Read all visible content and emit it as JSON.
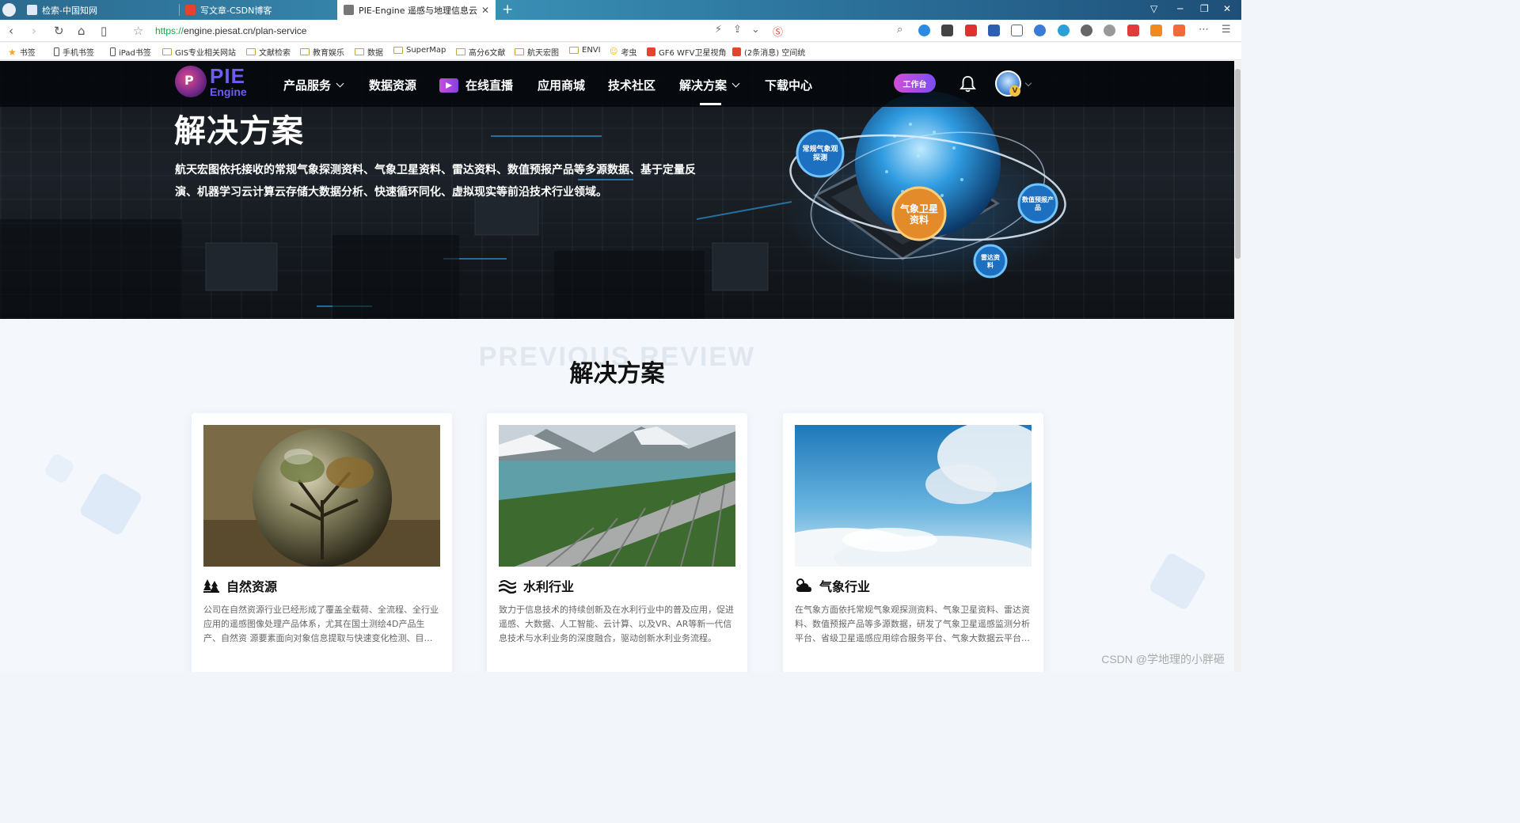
{
  "browser": {
    "tabs": [
      {
        "title": "检索-中国知网",
        "color": "#3b5b9b"
      },
      {
        "title": "写文章-CSDN博客",
        "color": "#e5432f"
      },
      {
        "title": "PIE-Engine 遥感与地理信息云服务平",
        "color": "#555555"
      }
    ],
    "url_scheme": "https://",
    "url_rest": "engine.piesat.cn/plan-service",
    "bookmarks": [
      {
        "label": "书签",
        "type": "star"
      },
      {
        "label": "手机书签",
        "type": "phone"
      },
      {
        "label": "iPad书签",
        "type": "phone"
      },
      {
        "label": "GIS专业相关网站",
        "type": "folder"
      },
      {
        "label": "文献检索",
        "type": "folder"
      },
      {
        "label": "教育娱乐",
        "type": "folder"
      },
      {
        "label": "数据",
        "type": "folder"
      },
      {
        "label": "SuperMap",
        "type": "folder"
      },
      {
        "label": "高分6文献",
        "type": "folder"
      },
      {
        "label": "航天宏图",
        "type": "folder"
      },
      {
        "label": "ENVI",
        "type": "folder"
      },
      {
        "label": "考虫",
        "type": "emoji"
      },
      {
        "label": "GF6 WFV卫星视角",
        "type": "csdn"
      },
      {
        "label": "(2条消息) 空间统",
        "type": "csdn"
      }
    ]
  },
  "site": {
    "logo_pie": "PIE",
    "logo_engine": "Engine",
    "logo_mark": "P",
    "nav": {
      "products": "产品服务",
      "data": "数据资源",
      "live": "在线直播",
      "store": "应用商城",
      "community": "技术社区",
      "solutions": "解决方案",
      "download": "下载中心"
    },
    "workbench": "工作台",
    "avatar_badge": "V"
  },
  "hero": {
    "title": "解决方案",
    "description": "航天宏图依托接收的常规气象探测资料、气象卫星资料、雷达资料、数值预报产品等多源数据、基于定量反演、机器学习云计算云存储大数据分析、快速循环同化、虚拟现实等前沿技术行业领域。",
    "bubbles": {
      "conventional": "常规气象观探测",
      "satellite": "气象卫星资料",
      "numerical": "数值预报产品",
      "radar": "雷达资料"
    }
  },
  "section": {
    "bg_text": "PREVIOUS REVIEW",
    "title": "解决方案"
  },
  "cards": [
    {
      "name": "自然资源",
      "icon": "trees-icon",
      "description": "公司在自然资源行业已经形成了覆盖全载荷、全流程、全行业应用的遥感图像处理产品体系，尤其在国土测绘4D产品生产、自然资 源要素面向对象信息提取与快速变化检测、目标识别等方面具有领先优势。"
    },
    {
      "name": "水利行业",
      "icon": "water-icon",
      "description": "致力于信息技术的持续创新及在水利行业中的普及应用，促进遥感、大数据、人工智能、云计算、以及VR、AR等新一代信息技术与水利业务的深度融合，驱动创新水利业务流程。"
    },
    {
      "name": "气象行业",
      "icon": "weather-icon",
      "description": "在气象方面依托常规气象观探测资料、气象卫星资料、雷达资料、数值预报产品等多源数据，研发了气象卫星遥感监测分析平台、省级卫星遥感应用综合服务平台、气象大数据云平台等产品。"
    }
  ],
  "watermark": "CSDN @学地理的小胖砸"
}
